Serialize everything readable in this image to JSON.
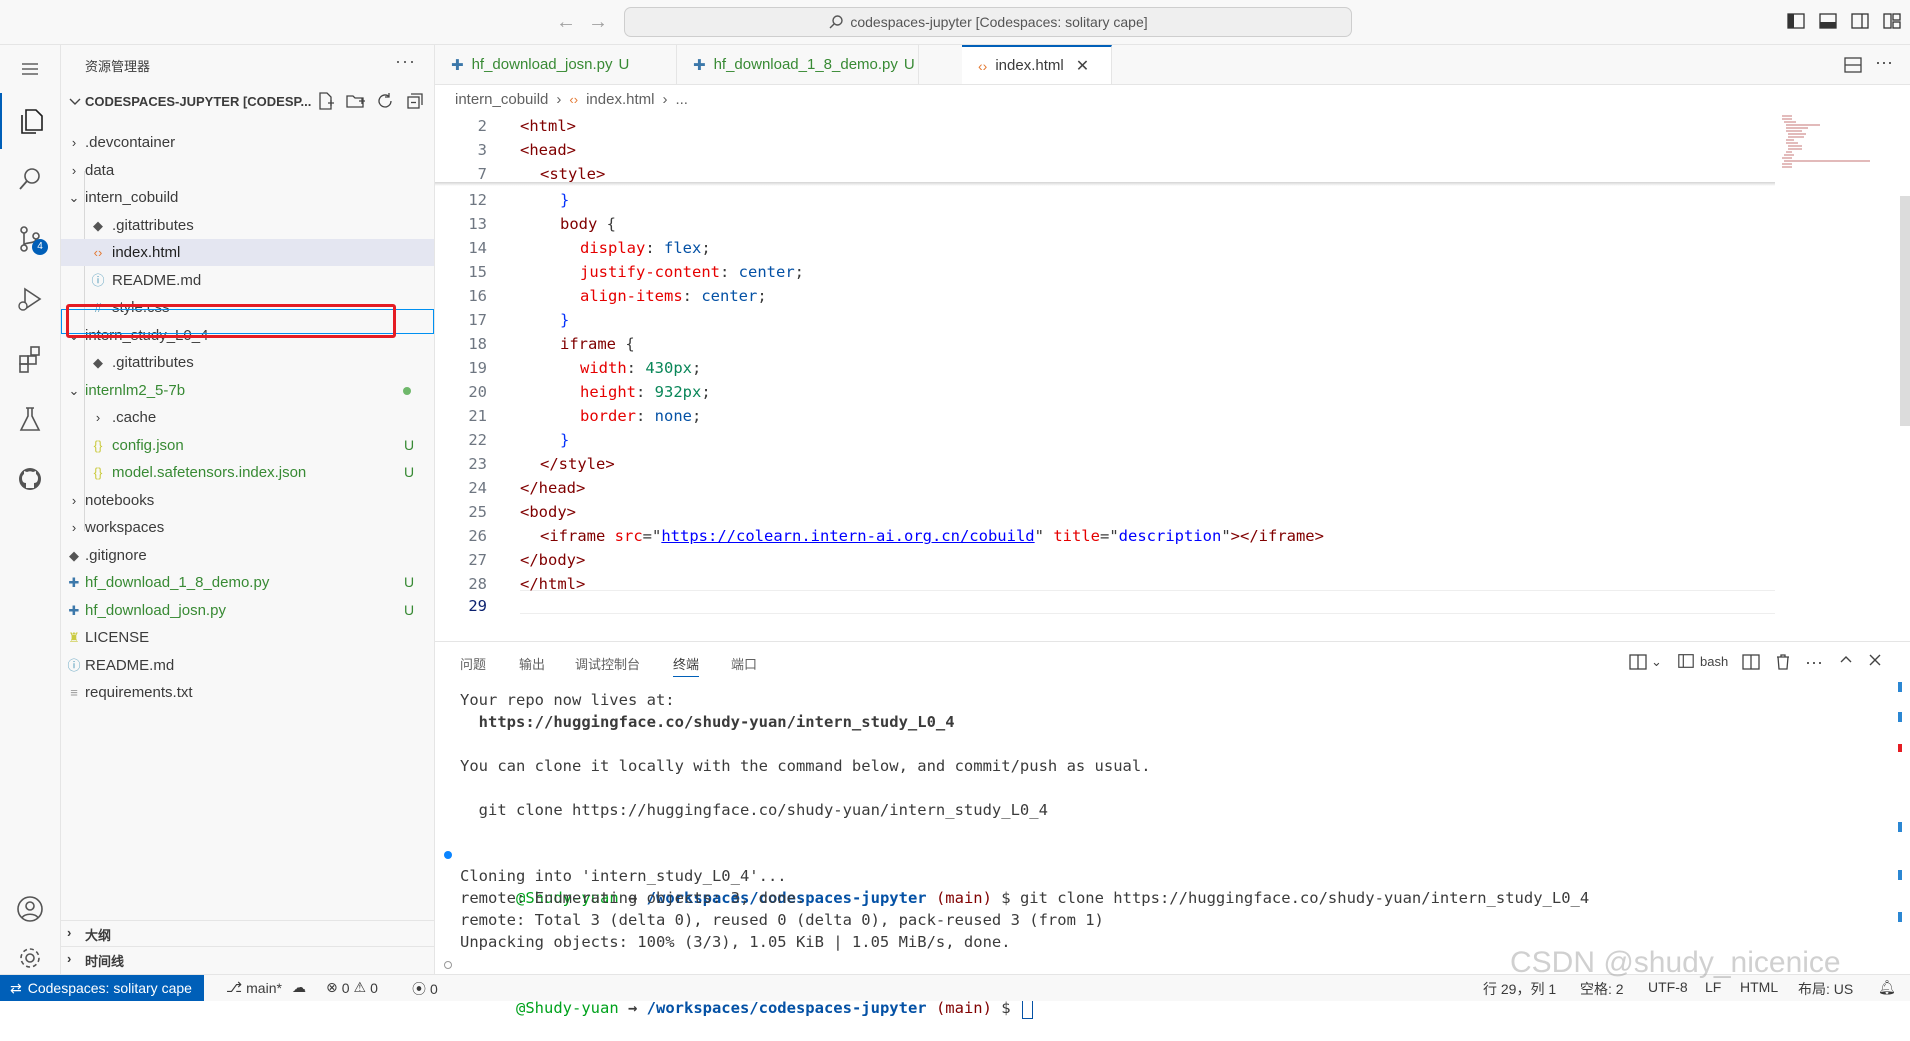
{
  "titlebar": {
    "search_text": "codespaces-jupyter [Codespaces: solitary cape]"
  },
  "sidebar": {
    "title": "资源管理器",
    "more": "···",
    "workspace_title": "CODESPACES-JUPYTER [CODESP...",
    "items": [
      {
        "name": ".devcontainer",
        "status": ""
      },
      {
        "name": "data",
        "status": ""
      },
      {
        "name": "intern_cobuild",
        "status": ""
      },
      {
        "name": ".gitattributes",
        "status": ""
      },
      {
        "name": "index.html",
        "status": ""
      },
      {
        "name": "README.md",
        "status": ""
      },
      {
        "name": "style.css",
        "status": ""
      },
      {
        "name": "intern_study_L0_4",
        "status": ""
      },
      {
        "name": ".gitattributes",
        "status": ""
      },
      {
        "name": "internlm2_5-7b",
        "status": ""
      },
      {
        "name": ".cache",
        "status": ""
      },
      {
        "name": "config.json",
        "status": "U"
      },
      {
        "name": "model.safetensors.index.json",
        "status": "U"
      },
      {
        "name": "notebooks",
        "status": ""
      },
      {
        "name": "workspaces",
        "status": ""
      },
      {
        "name": ".gitignore",
        "status": ""
      },
      {
        "name": "hf_download_1_8_demo.py",
        "status": "U"
      },
      {
        "name": "hf_download_josn.py",
        "status": "U"
      },
      {
        "name": "LICENSE",
        "status": ""
      },
      {
        "name": "README.md",
        "status": ""
      },
      {
        "name": "requirements.txt",
        "status": ""
      }
    ],
    "outline_label": "大纲",
    "timeline_label": "时间线"
  },
  "activity": {
    "scm_badge": "4"
  },
  "tabs": [
    {
      "label": "hf_download_josn.py",
      "status": "U"
    },
    {
      "label": "hf_download_1_8_demo.py",
      "status": "U"
    },
    {
      "label": "index.html",
      "close": "✕"
    }
  ],
  "breadcrumb": {
    "folder": "intern_cobuild",
    "file": "index.html",
    "more": "..."
  },
  "editor": {
    "lines": [
      {
        "n": "2"
      },
      {
        "n": "3"
      },
      {
        "n": "7"
      },
      {
        "n": "12"
      },
      {
        "n": "13"
      },
      {
        "n": "14"
      },
      {
        "n": "15"
      },
      {
        "n": "16"
      },
      {
        "n": "17"
      },
      {
        "n": "18"
      },
      {
        "n": "19"
      },
      {
        "n": "20"
      },
      {
        "n": "21"
      },
      {
        "n": "22"
      },
      {
        "n": "23"
      },
      {
        "n": "24"
      },
      {
        "n": "25"
      },
      {
        "n": "26"
      },
      {
        "n": "27"
      },
      {
        "n": "28"
      },
      {
        "n": "29"
      }
    ],
    "code": {
      "l2": "<html>",
      "l3": "<head>",
      "l7": "<style>",
      "l12": "}",
      "l13_sel": "body",
      "l13_brace": " {",
      "l14_prop": "display",
      "l14_val": "flex",
      "l15_prop": "justify-content",
      "l15_val": "center",
      "l16_prop": "align-items",
      "l16_val": "center",
      "l17": "}",
      "l18_sel": "iframe",
      "l18_brace": " {",
      "l19_prop": "width",
      "l19_val": "430px",
      "l20_prop": "height",
      "l20_val": "932px",
      "l21_prop": "border",
      "l21_val": "none",
      "l22": "}",
      "l23": "</style>",
      "l24": "</head>",
      "l25": "<body>",
      "l26_open": "<iframe",
      "l26_src_attr": "src",
      "l26_src_val": "https://colearn.intern-ai.org.cn/cobuild",
      "l26_title_attr": "title",
      "l26_title_val": "description",
      "l26_close": "></iframe>",
      "l27": "</body>",
      "l28": "</html>"
    }
  },
  "panel": {
    "tabs": [
      "问题",
      "输出",
      "调试控制台",
      "终端",
      "端口"
    ],
    "shell": "bash",
    "terminal": {
      "l1": "Your repo now lives at:",
      "l2": "  https://huggingface.co/shudy-yuan/intern_study_L0_4",
      "l3": "You can clone it locally with the command below, and commit/push as usual.",
      "l4": "  git clone https://huggingface.co/shudy-yuan/intern_study_L0_4",
      "prompt_user": "@Shudy-yuan",
      "prompt_arrow": " → ",
      "prompt_path": "/workspaces/codespaces-jupyter",
      "prompt_branch": "(main)",
      "prompt_sym": " $ ",
      "cmd": "git clone https://huggingface.co/shudy-yuan/intern_study_L0_4",
      "o1": "Cloning into 'intern_study_L0_4'...",
      "o2": "remote: Enumerating objects: 3, done.",
      "o3": "remote: Total 3 (delta 0), reused 0 (delta 0), pack-reused 3 (from 1)",
      "o4": "Unpacking objects: 100% (3/3), 1.05 KiB | 1.05 MiB/s, done."
    }
  },
  "status": {
    "remote": "Codespaces: solitary cape",
    "branch": "main*",
    "errors": "0",
    "warnings": "0",
    "ports": "0",
    "position": "行 29，列 1",
    "spaces": "空格: 2",
    "encoding": "UTF-8",
    "eol": "LF",
    "language": "HTML",
    "layout": "布局: US"
  },
  "watermark": "CSDN @shudy_nicenice",
  "colors": {
    "accent": "#005fb8",
    "git_untracked": "#388a34",
    "highlight_box": "#e51c23"
  }
}
